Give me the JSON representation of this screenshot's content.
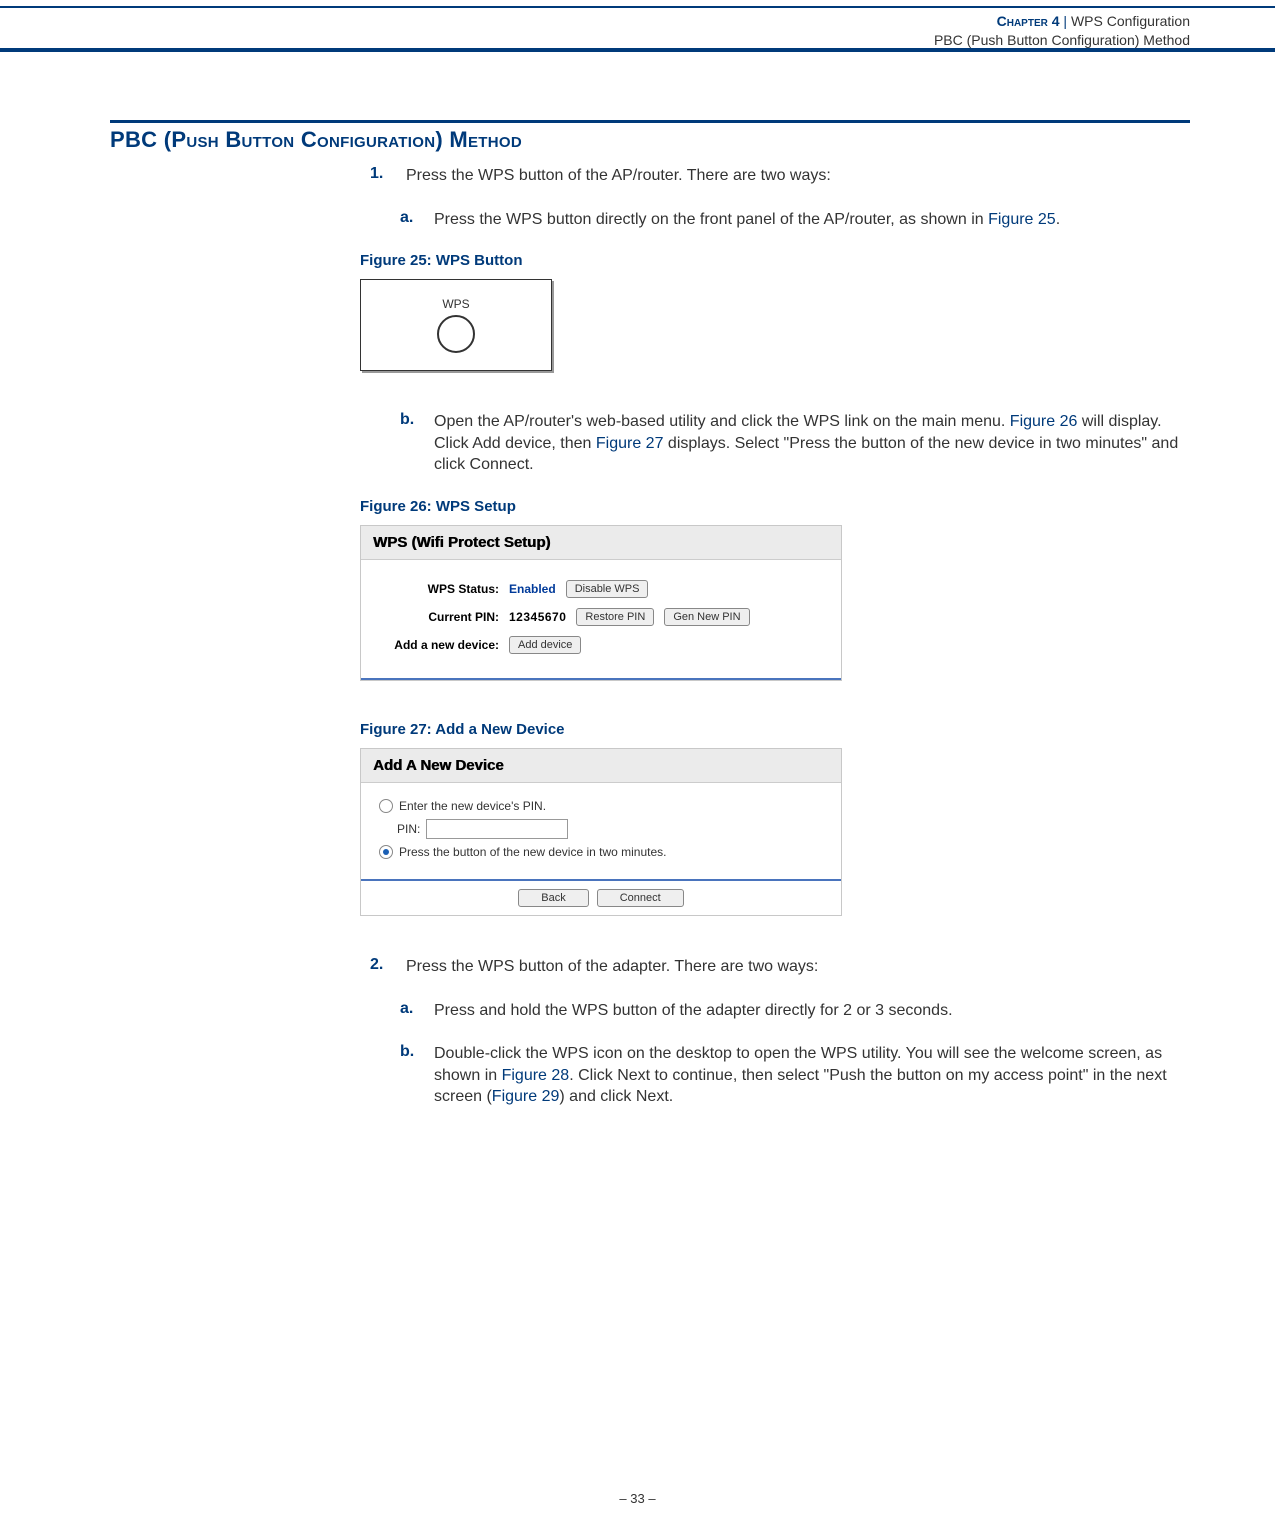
{
  "header": {
    "chapter": "Chapter 4",
    "separator": "|",
    "topic": "WPS Configuration",
    "subtitle": "PBC (Push Button Configuration) Method"
  },
  "section_title": "PBC (Push Button Configuration) Method",
  "step1": {
    "num": "1.",
    "text": "Press the WPS button of the AP/router. There are two ways:",
    "a": {
      "label": "a.",
      "pre": "Press the WPS button directly on the front panel of the AP/router, as shown in ",
      "ref": "Figure 25",
      "post": "."
    },
    "b": {
      "label": "b.",
      "p1": "Open the AP/router's web-based utility and click the WPS link on the main menu. ",
      "ref1": "Figure 26",
      "p2": " will display. Click Add device, then ",
      "ref2": "Figure 27",
      "p3": " displays. Select \"Press the button of the new device in two minutes\" and click Connect."
    }
  },
  "fig25": {
    "caption": "Figure 25:  WPS Button",
    "label": "WPS"
  },
  "fig26": {
    "caption": "Figure 26:  WPS Setup",
    "title": "WPS (Wifi Protect Setup)",
    "status_label": "WPS Status:",
    "status_value": "Enabled",
    "disable_btn": "Disable WPS",
    "pin_label": "Current PIN:",
    "pin_value": "12345670",
    "restore_btn": "Restore PIN",
    "gen_btn": "Gen New PIN",
    "add_label": "Add a new device:",
    "add_btn": "Add device"
  },
  "fig27": {
    "caption": "Figure 27:  Add a New Device",
    "title": "Add A New Device",
    "opt1": "Enter the new device's PIN.",
    "pin_label": "PIN:",
    "opt2": "Press the button of the new device in two minutes.",
    "back_btn": "Back",
    "connect_btn": "Connect"
  },
  "step2": {
    "num": "2.",
    "text": "Press the WPS button of the adapter. There are two ways:",
    "a": {
      "label": "a.",
      "text": "Press and hold the WPS button of the adapter directly for 2 or 3 seconds."
    },
    "b": {
      "label": "b.",
      "p1": "Double-click the WPS icon on the desktop to open the WPS utility. You will see the welcome screen, as shown in ",
      "ref1": "Figure 28",
      "p2": ". Click Next to continue, then select \"Push the button on my access point\" in the next screen (",
      "ref2": "Figure 29",
      "p3": ") and click Next."
    }
  },
  "footer": "–  33  –"
}
